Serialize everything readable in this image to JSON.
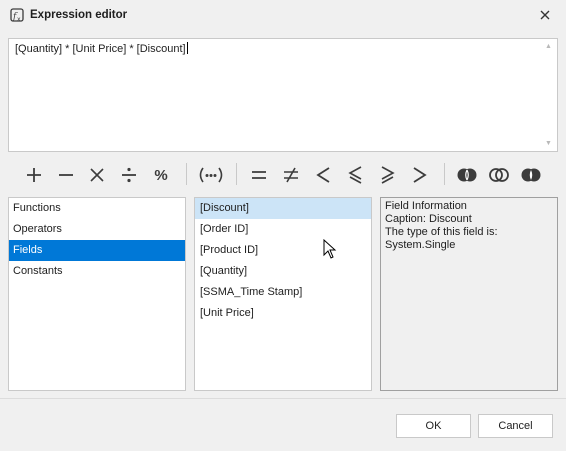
{
  "window": {
    "title": "Expression editor",
    "icon": "function-icon",
    "close": "close-icon"
  },
  "expression": {
    "text": "[Quantity] * [Unit Price] * [Discount]"
  },
  "toolbar": {
    "operators": [
      {
        "name": "plus",
        "symbol": "+"
      },
      {
        "name": "minus",
        "symbol": "−"
      },
      {
        "name": "multiply",
        "symbol": "×"
      },
      {
        "name": "divide",
        "symbol": "÷"
      },
      {
        "name": "modulo",
        "symbol": "%"
      },
      {
        "name": "brackets",
        "symbol": "(•••)"
      },
      {
        "name": "equal",
        "symbol": "="
      },
      {
        "name": "not-equal",
        "symbol": "≠"
      },
      {
        "name": "less",
        "symbol": "<"
      },
      {
        "name": "less-or-equal",
        "symbol": "≤"
      },
      {
        "name": "greater-or-equal",
        "symbol": "≥"
      },
      {
        "name": "greater",
        "symbol": ">"
      },
      {
        "name": "and",
        "symbol": "and"
      },
      {
        "name": "or",
        "symbol": "or"
      },
      {
        "name": "not",
        "symbol": "not"
      }
    ]
  },
  "categories": {
    "items": [
      "Functions",
      "Operators",
      "Fields",
      "Constants"
    ],
    "selected": "Fields"
  },
  "fields": {
    "items": [
      "[Discount]",
      "[Order ID]",
      "[Product ID]",
      "[Quantity]",
      "[SSMA_Time Stamp]",
      "[Unit Price]"
    ],
    "hovered": "[Discount]"
  },
  "info": {
    "lines": [
      "Field Information",
      "Caption: Discount",
      "The type of this field is:",
      "System.Single"
    ]
  },
  "buttons": {
    "ok": "OK",
    "cancel": "Cancel"
  },
  "colors": {
    "selection": "#0078d7",
    "hover": "#cce4f7",
    "icon": "#3c3c3c"
  }
}
